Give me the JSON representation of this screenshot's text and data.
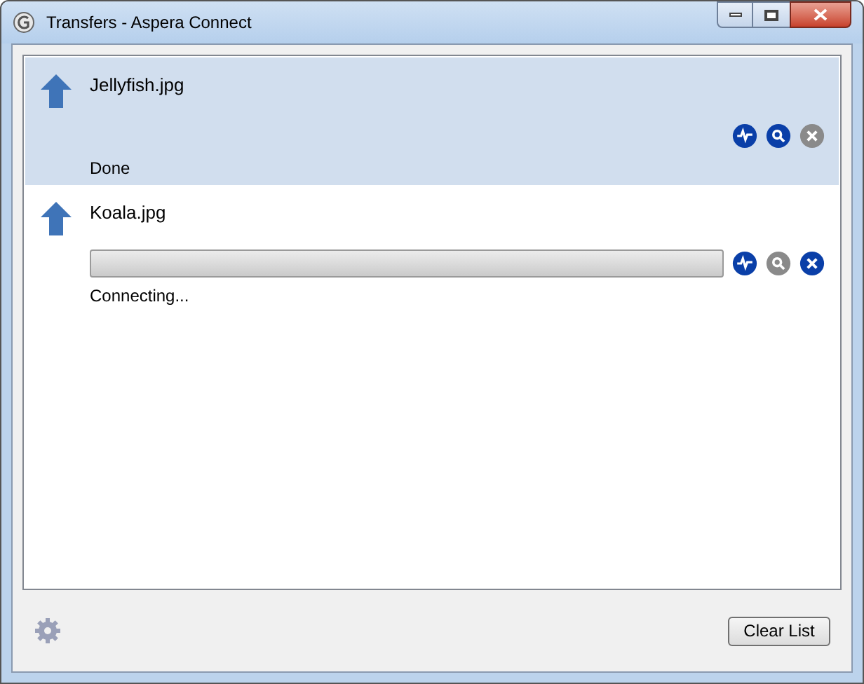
{
  "window": {
    "title": "Transfers - Aspera Connect"
  },
  "transfers": [
    {
      "kind": "finished",
      "name": "Jellyfish.jpg",
      "selected": true,
      "status": "Done",
      "actions": [
        {
          "kind": "details",
          "disabled": false
        },
        {
          "kind": "reveal",
          "disabled": false
        },
        {
          "kind": "cancel",
          "disabled": true
        }
      ]
    },
    {
      "kind": "pending",
      "name": "Koala.jpg",
      "selected": false,
      "status": "Connecting...",
      "actions": [
        {
          "kind": "details",
          "disabled": false
        },
        {
          "kind": "reveal",
          "disabled": true
        },
        {
          "kind": "cancel",
          "disabled": false
        }
      ]
    }
  ],
  "footer": {
    "button": "Clear List"
  }
}
